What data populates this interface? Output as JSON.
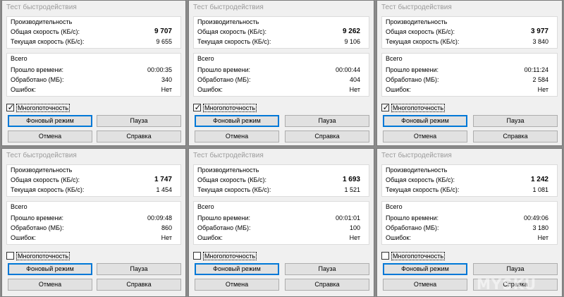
{
  "window": {
    "title": "Тест быстродействия",
    "perf_label": "Производительность",
    "total_speed_label": "Общая скорость (КБ/с):",
    "current_speed_label": "Текущая скорость (КБ/с):",
    "total_label": "Всего",
    "elapsed_label": "Прошло времени:",
    "processed_label": "Обработано (МБ):",
    "errors_label": "Ошибок:",
    "multithread_label": "Многопоточность",
    "background_button": "Фоновый режим",
    "pause_button": "Пауза",
    "cancel_button": "Отмена",
    "help_button": "Справка"
  },
  "panels": [
    {
      "total_speed": "9 707",
      "current_speed": "9 655",
      "elapsed": "00:00:35",
      "processed": "340",
      "errors": "Нет",
      "multithread_checked": true
    },
    {
      "total_speed": "9 262",
      "current_speed": "9 106",
      "elapsed": "00:00:44",
      "processed": "404",
      "errors": "Нет",
      "multithread_checked": true
    },
    {
      "total_speed": "3 977",
      "current_speed": "3 840",
      "elapsed": "00:11:24",
      "processed": "2 584",
      "errors": "Нет",
      "multithread_checked": true
    },
    {
      "total_speed": "1 747",
      "current_speed": "1 454",
      "elapsed": "00:09:48",
      "processed": "860",
      "errors": "Нет",
      "multithread_checked": false
    },
    {
      "total_speed": "1 693",
      "current_speed": "1 521",
      "elapsed": "00:01:01",
      "processed": "100",
      "errors": "Нет",
      "multithread_checked": false
    },
    {
      "total_speed": "1 242",
      "current_speed": "1 081",
      "elapsed": "00:49:06",
      "processed": "3 180",
      "errors": "Нет",
      "multithread_checked": false
    }
  ],
  "watermark": "MYSKU"
}
